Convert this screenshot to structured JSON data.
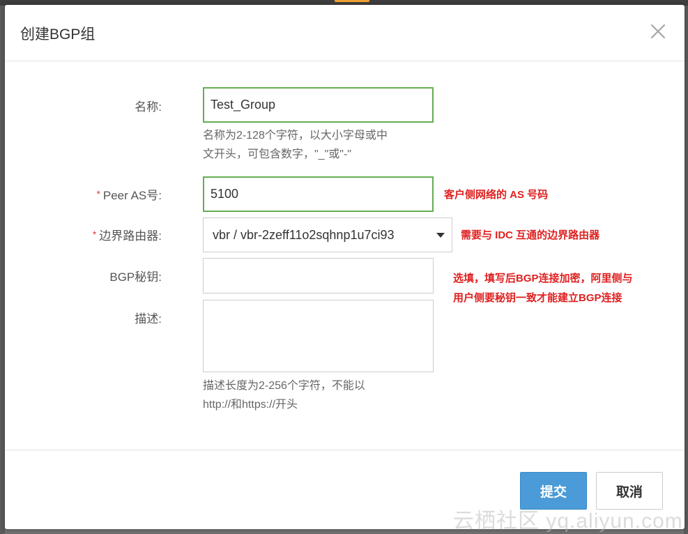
{
  "dialog": {
    "title": "创建BGP组",
    "close_icon": "close-icon"
  },
  "form": {
    "name": {
      "label": "名称:",
      "value": "Test_Group",
      "help_line1": "名称为2-128个字符，以大小字母或中",
      "help_line2": "文开头，可包含数字，\"_\"或\"-\""
    },
    "peer_as": {
      "required_mark": "*",
      "label": "Peer AS号:",
      "value": "5100"
    },
    "router": {
      "required_mark": "*",
      "label": "边界路由器:",
      "selected": "vbr / vbr-2zeff11o2sqhnp1u7ci93",
      "caret_icon": "caret-down-icon"
    },
    "bgp_key": {
      "label": "BGP秘钥:",
      "value": ""
    },
    "description": {
      "label": "描述:",
      "value": "",
      "help_line1": "描述长度为2-256个字符，不能以",
      "help_line2": "http://和https://开头"
    }
  },
  "annotations": {
    "peer_as": "客户侧网络的 AS 号码",
    "router": "需要与 IDC 互通的边界路由器",
    "bgp_key_line1": "选填，填写后BGP连接加密，阿里侧与",
    "bgp_key_line2": "用户侧要秘钥一致才能建立BGP连接"
  },
  "footer": {
    "submit_label": "提交",
    "cancel_label": "取消"
  },
  "watermark": "云栖社区 yq.aliyun.com",
  "colors": {
    "primary": "#4a9bd7",
    "focus_border": "#65ad52",
    "annotation": "#e02020",
    "required": "#e4393c"
  }
}
